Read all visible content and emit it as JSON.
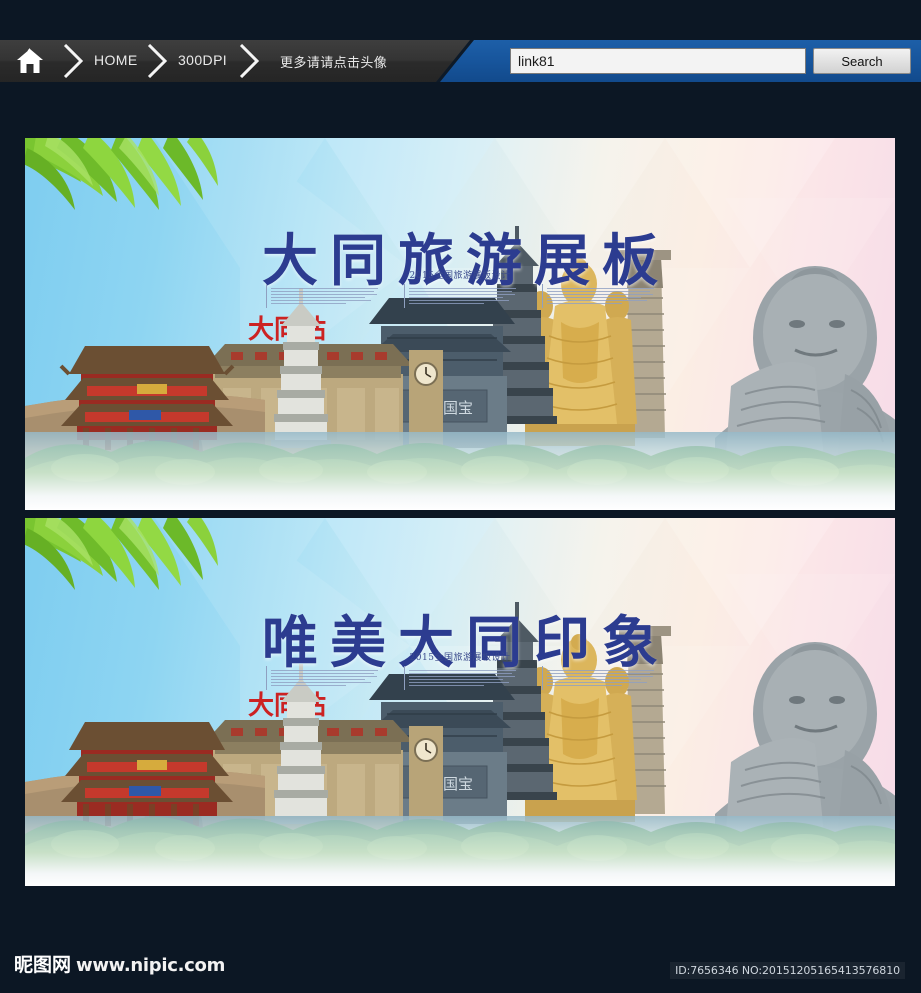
{
  "nav": {
    "home_icon": "home-icon",
    "items": [
      {
        "label": "HOME"
      },
      {
        "label": "300DPI"
      },
      {
        "label": "更多请请点击头像"
      }
    ]
  },
  "search": {
    "value": "link81",
    "placeholder": "",
    "button_label": "Search"
  },
  "banners": [
    {
      "id": "banner-1",
      "title": "大同旅游展板",
      "subtitle": "2015全国旅游展板设计",
      "landmark_signs": [
        {
          "name": "datong-station-sign",
          "text": "大同站"
        },
        {
          "name": "temple-plaque",
          "text": "宝石国宝"
        }
      ]
    },
    {
      "id": "banner-2",
      "title": "唯美大同印象",
      "subtitle": "2015全国旅游展板设计",
      "landmark_signs": [
        {
          "name": "datong-station-sign",
          "text": "大同站"
        },
        {
          "name": "temple-plaque",
          "text": "宝石国宝"
        }
      ]
    }
  ],
  "footer": {
    "logo_cjk": "昵图网",
    "logo_url": "www.nipic.com",
    "id_code": "ID:7656346 NO:20151205165413576810"
  },
  "colors": {
    "page_background": "#0c1724",
    "nav_dark": "#333333",
    "nav_blue": "#17559c",
    "title_blue": "#2c3c90",
    "sky_blue": "#7ecdf0",
    "sky_pink": "#f6dbe8"
  }
}
